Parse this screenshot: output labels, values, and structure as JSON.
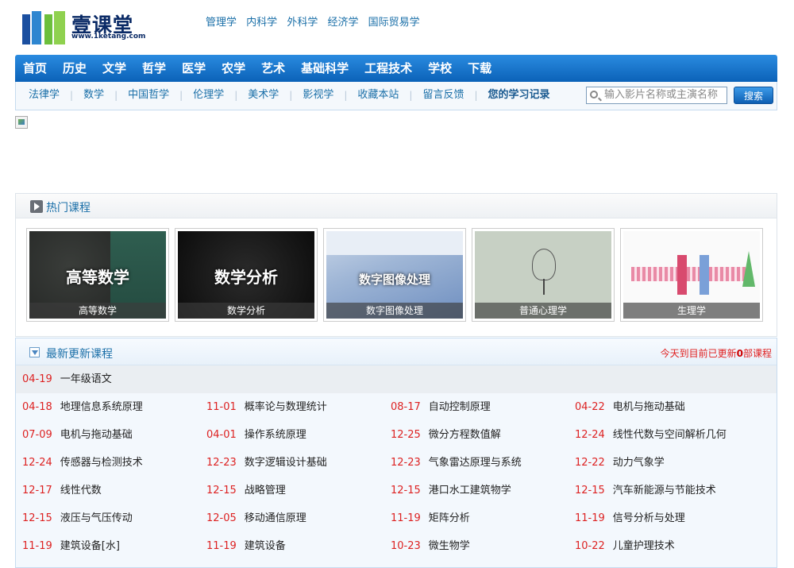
{
  "brand": {
    "name": "壹课堂",
    "url": "www.1ketang.com"
  },
  "top_links": [
    "管理学",
    "内科学",
    "外科学",
    "经济学",
    "国际贸易学"
  ],
  "nav": [
    "首页",
    "历史",
    "文学",
    "哲学",
    "医学",
    "农学",
    "艺术",
    "基础科学",
    "工程技术",
    "学校",
    "下载"
  ],
  "subnav": [
    "法律学",
    "数学",
    "中国哲学",
    "伦理学",
    "美术学",
    "影视学",
    "收藏本站",
    "留言反馈",
    "您的学习记录"
  ],
  "search": {
    "placeholder": "输入影片名称或主演名称",
    "button": "搜索"
  },
  "hot": {
    "title": "热门课程",
    "courses": [
      {
        "thumb_text": "高等数学",
        "caption": "高等数学"
      },
      {
        "thumb_text": "数学分析",
        "caption": "数学分析"
      },
      {
        "thumb_text": "数字图像处理",
        "caption": "数字图像处理"
      },
      {
        "thumb_text": "",
        "caption": "普通心理学"
      },
      {
        "thumb_text": "",
        "caption": "生理学"
      }
    ]
  },
  "latest": {
    "title": "最新更新课程",
    "status_prefix": "今天到目前已更新",
    "status_count": "0",
    "status_suffix": "部课程",
    "first": {
      "date": "04-19",
      "name": "一年级语文"
    },
    "rows": [
      [
        {
          "date": "04-18",
          "name": "地理信息系统原理"
        },
        {
          "date": "11-01",
          "name": "概率论与数理统计"
        },
        {
          "date": "08-17",
          "name": "自动控制原理"
        },
        {
          "date": "04-22",
          "name": "电机与拖动基础"
        }
      ],
      [
        {
          "date": "07-09",
          "name": "电机与拖动基础"
        },
        {
          "date": "04-01",
          "name": "操作系统原理"
        },
        {
          "date": "12-25",
          "name": "微分方程数值解"
        },
        {
          "date": "12-24",
          "name": "线性代数与空间解析几何"
        }
      ],
      [
        {
          "date": "12-24",
          "name": "传感器与检测技术"
        },
        {
          "date": "12-23",
          "name": "数字逻辑设计基础"
        },
        {
          "date": "12-23",
          "name": "气象雷达原理与系统"
        },
        {
          "date": "12-22",
          "name": "动力气象学"
        }
      ],
      [
        {
          "date": "12-17",
          "name": "线性代数"
        },
        {
          "date": "12-15",
          "name": "战略管理"
        },
        {
          "date": "12-15",
          "name": "港口水工建筑物学"
        },
        {
          "date": "12-15",
          "name": "汽车新能源与节能技术"
        }
      ],
      [
        {
          "date": "12-15",
          "name": "液压与气压传动"
        },
        {
          "date": "12-05",
          "name": "移动通信原理"
        },
        {
          "date": "11-19",
          "name": "矩阵分析"
        },
        {
          "date": "11-19",
          "name": "信号分析与处理"
        }
      ],
      [
        {
          "date": "11-19",
          "name": "建筑设备[水]"
        },
        {
          "date": "11-19",
          "name": "建筑设备"
        },
        {
          "date": "10-23",
          "name": "微生物学"
        },
        {
          "date": "10-22",
          "name": "儿童护理技术"
        }
      ]
    ]
  },
  "colors": {
    "nav": "#0b62b8",
    "link": "#1a6fa8",
    "date": "#dd2222"
  }
}
